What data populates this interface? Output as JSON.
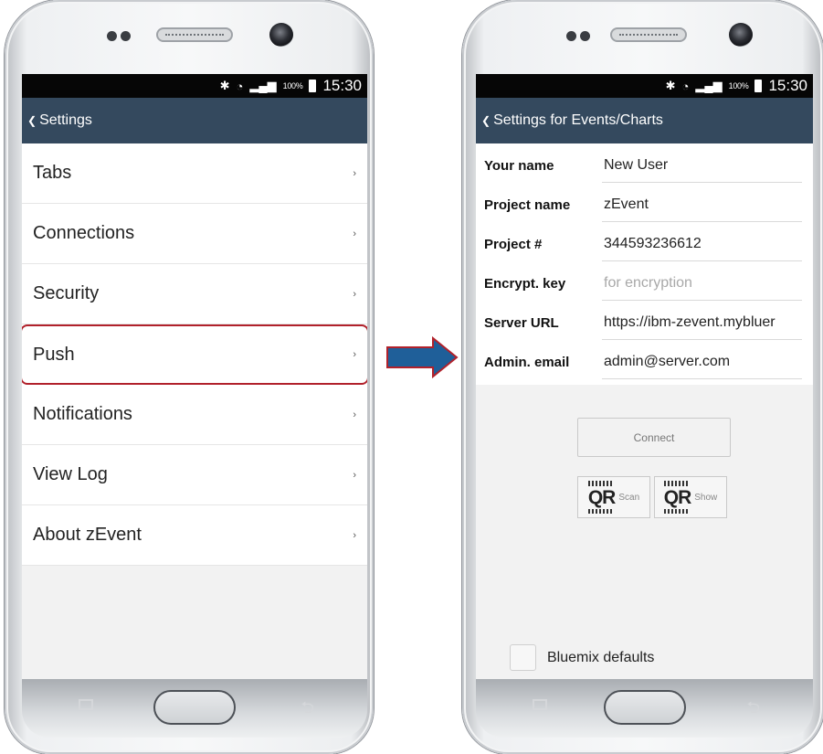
{
  "status_bar": {
    "signal_label": "100%",
    "time": "15:30"
  },
  "left_screen": {
    "header_title": "Settings",
    "menu_items": [
      {
        "label": "Tabs"
      },
      {
        "label": "Connections"
      },
      {
        "label": "Security"
      },
      {
        "label": "Push"
      },
      {
        "label": "Notifications"
      },
      {
        "label": "View Log"
      },
      {
        "label": "About zEvent"
      }
    ],
    "highlighted_item": "Push",
    "highlight_color": "#b1212b"
  },
  "right_screen": {
    "header_title": "Settings for Events/Charts",
    "fields": [
      {
        "label": "Your name",
        "value": "New User",
        "placeholder": ""
      },
      {
        "label": "Project name",
        "value": "zEvent",
        "placeholder": ""
      },
      {
        "label": "Project #",
        "value": "344593236612",
        "placeholder": ""
      },
      {
        "label": "Encrypt. key",
        "value": "",
        "placeholder": "for encryption"
      },
      {
        "label": "Server URL",
        "value": "https://ibm-zevent.mybluer",
        "placeholder": ""
      },
      {
        "label": "Admin. email",
        "value": "admin@server.com",
        "placeholder": ""
      }
    ],
    "connect_label": "Connect",
    "qr_scan": {
      "qr": "QR",
      "label": "Scan"
    },
    "qr_show": {
      "qr": "QR",
      "label": "Show"
    },
    "bluemix_label": "Bluemix defaults",
    "bluemix_checked": false
  },
  "colors": {
    "header_bg": "#34495e",
    "status_bg": "#060606",
    "arrow_fill": "#1f5f99",
    "arrow_stroke": "#b1212b"
  }
}
